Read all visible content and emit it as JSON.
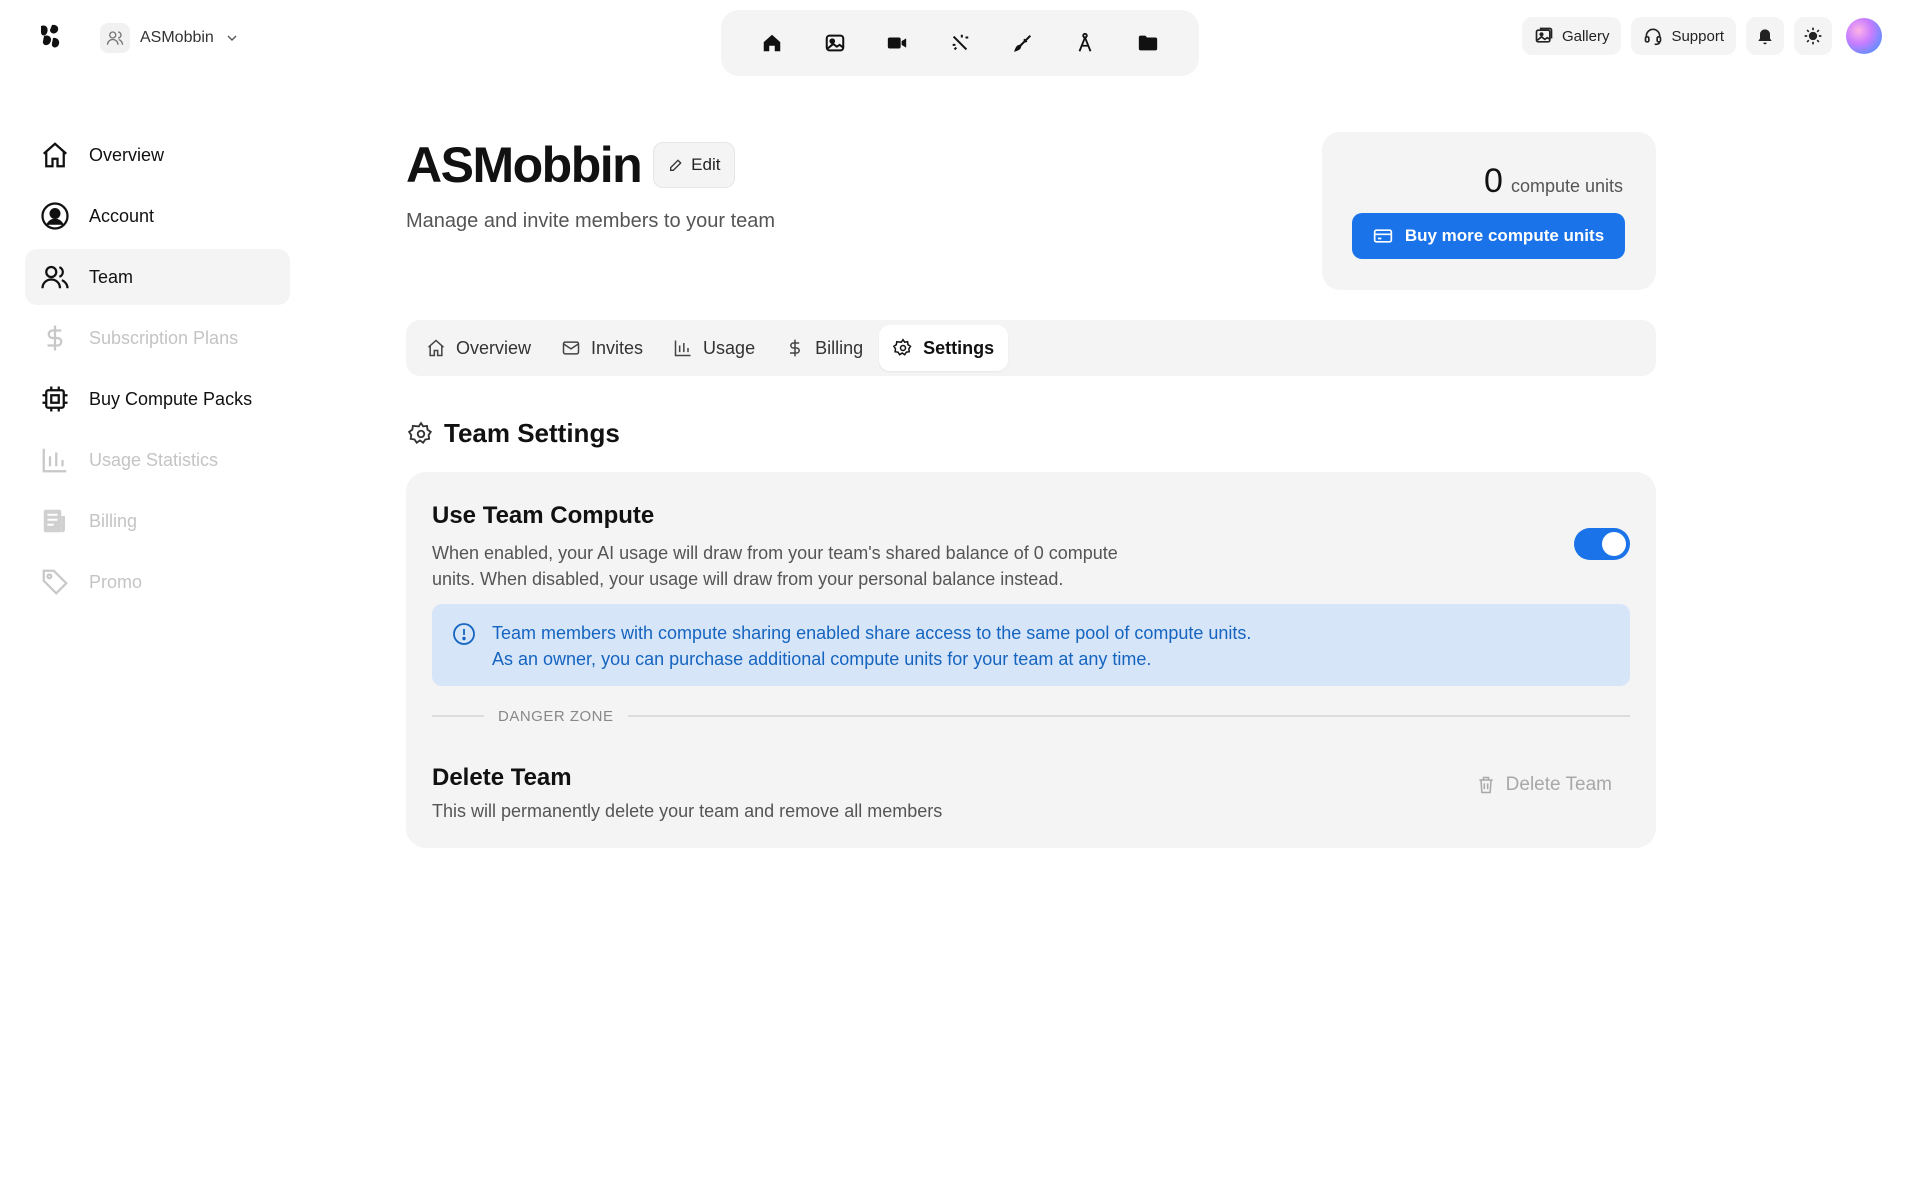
{
  "header": {
    "team_name": "ASMobbin",
    "gallery_label": "Gallery",
    "support_label": "Support"
  },
  "toolbar": {
    "tools": [
      "home-icon",
      "image-icon",
      "video-icon",
      "magic-wand-icon",
      "brush-icon",
      "compass-icon",
      "folder-icon"
    ]
  },
  "sidebar": {
    "items": [
      {
        "label": "Overview",
        "icon": "home-icon",
        "state": "normal"
      },
      {
        "label": "Account",
        "icon": "user-circle-icon",
        "state": "normal"
      },
      {
        "label": "Team",
        "icon": "users-icon",
        "state": "active"
      },
      {
        "label": "Subscription Plans",
        "icon": "dollar-icon",
        "state": "disabled"
      },
      {
        "label": "Buy Compute Packs",
        "icon": "chip-icon",
        "state": "normal"
      },
      {
        "label": "Usage Statistics",
        "icon": "bar-chart-icon",
        "state": "disabled"
      },
      {
        "label": "Billing",
        "icon": "receipt-icon",
        "state": "disabled"
      },
      {
        "label": "Promo",
        "icon": "tag-icon",
        "state": "disabled"
      }
    ]
  },
  "main": {
    "title": "ASMobbin",
    "edit_label": "Edit",
    "subtitle": "Manage and invite members to your team",
    "compute": {
      "amount": "0",
      "unit": "compute units",
      "buy_label": "Buy more compute units"
    },
    "tabs": [
      {
        "label": "Overview",
        "icon": "home-icon",
        "active": false
      },
      {
        "label": "Invites",
        "icon": "mail-icon",
        "active": false
      },
      {
        "label": "Usage",
        "icon": "bar-chart-icon",
        "active": false
      },
      {
        "label": "Billing",
        "icon": "dollar-icon",
        "active": false
      },
      {
        "label": "Settings",
        "icon": "gear-icon",
        "active": true
      }
    ],
    "section_title": "Team Settings",
    "team_compute": {
      "title": "Use Team Compute",
      "description_line1": "When enabled, your AI usage will draw from your team's shared balance of 0 compute",
      "description_line2": "units. When disabled, your usage will draw from your personal balance instead.",
      "enabled": true
    },
    "info": {
      "line1": "Team members with compute sharing enabled share access to the same pool of compute units.",
      "line2": "As an owner, you can purchase additional compute units for your team at any time."
    },
    "danger_zone_label": "DANGER ZONE",
    "delete": {
      "title": "Delete Team",
      "description": "This will permanently delete your team and remove all members",
      "button_label": "Delete Team"
    }
  },
  "colors": {
    "accent": "#1a73e8",
    "panel": "#f4f4f5",
    "info_bg": "#d7e5f9",
    "info_text": "#1565c0"
  }
}
